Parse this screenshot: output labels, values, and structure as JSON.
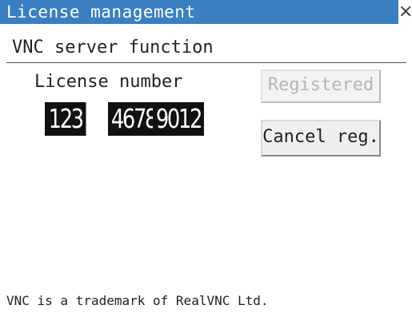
{
  "window": {
    "title": "License management",
    "close_glyph": "×"
  },
  "section": {
    "title": "VNC server function"
  },
  "license": {
    "label": "License number",
    "parts": [
      "123",
      "4678",
      "9012"
    ]
  },
  "buttons": {
    "registered_label": "Registered",
    "cancel_label": "Cancel reg."
  },
  "footer": {
    "text": "VNC is a trademark of RealVNC Ltd."
  },
  "colors": {
    "titlebar": "#3a7fc1",
    "license_box": "#111111"
  }
}
